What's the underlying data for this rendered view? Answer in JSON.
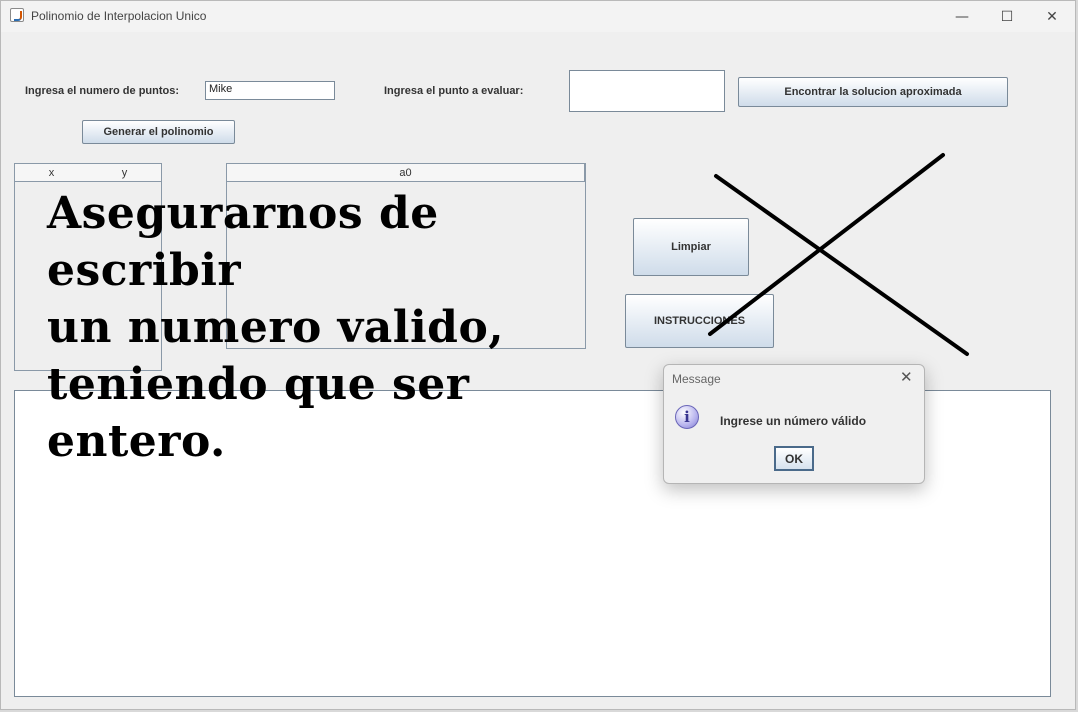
{
  "window": {
    "title": "Polinomio de Interpolacion Unico",
    "controls": {
      "minimize": "—",
      "maximize": "☐",
      "close": "✕"
    }
  },
  "form": {
    "points_label": "Ingresa el numero de puntos:",
    "points_value": "Mike",
    "eval_label": "Ingresa el punto a evaluar:",
    "eval_value": "",
    "find_button": "Encontrar la solucion aproximada",
    "generate_button": "Generar el polinomio",
    "clear_button": "Limpiar",
    "instructions_button": "INSTRUCCIONES"
  },
  "points_table": {
    "headers": [
      "x",
      "y"
    ]
  },
  "coef_table": {
    "headers": [
      "a0"
    ]
  },
  "annotation": {
    "lines": [
      "Asegurarnos de escribir",
      "un numero valido,",
      "teniendo que ser entero."
    ],
    "mark_color": "#000000"
  },
  "dialog": {
    "title": "Message",
    "close": "✕",
    "icon": "info-icon",
    "message": "Ingrese un número válido",
    "ok": "OK"
  }
}
